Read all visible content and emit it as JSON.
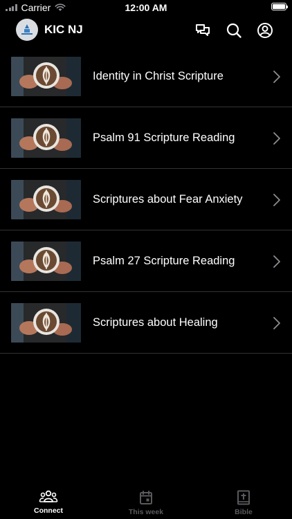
{
  "status_bar": {
    "carrier": "Carrier",
    "time": "12:00 AM"
  },
  "header": {
    "title": "KIC NJ",
    "icons": [
      "chat-bubbles-icon",
      "search-icon",
      "profile-icon"
    ]
  },
  "list": {
    "items": [
      {
        "label": "Identity in Christ Scripture"
      },
      {
        "label": "Psalm 91 Scripture Reading"
      },
      {
        "label": "Scriptures about Fear Anxiety"
      },
      {
        "label": "Psalm 27 Scripture Reading"
      },
      {
        "label": "Scriptures about Healing"
      }
    ]
  },
  "tab_bar": {
    "tabs": [
      {
        "label": "Connect",
        "icon": "people-icon",
        "active": true
      },
      {
        "label": "This week",
        "icon": "calendar-icon",
        "active": false
      },
      {
        "label": "Bible",
        "icon": "bible-icon",
        "active": false
      }
    ]
  },
  "colors": {
    "background": "#000000",
    "text": "#ffffff",
    "inactive_tab": "#5a5a5e",
    "divider": "#333333",
    "chevron": "#8e8e93"
  }
}
